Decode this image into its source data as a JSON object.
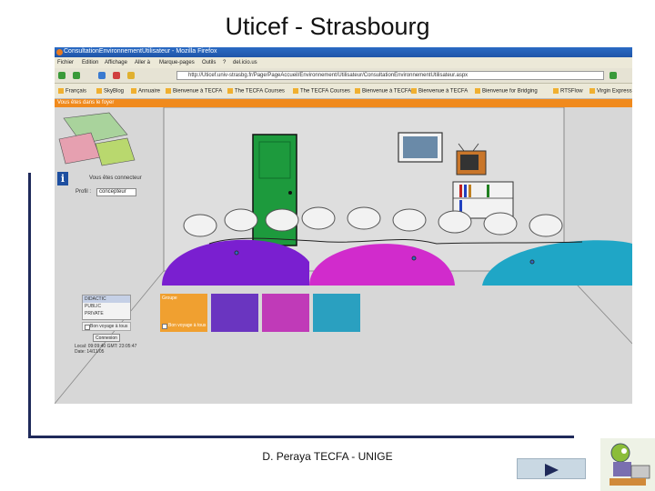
{
  "slide": {
    "title": "Uticef - Strasbourg",
    "footer": "D. Peraya TECFA - UNIGE"
  },
  "browser": {
    "window_title": "ConsultationEnvironnementUtilisateur - Mozilla Firefox",
    "menu": [
      "Fichier",
      "Edition",
      "Affichage",
      "Aller à",
      "Marque-pages",
      "Outils",
      "?",
      "del.icio.us"
    ],
    "url": "http://Uticef.univ-strasbg.fr/Page/PageAccueil/Environnement/Utilisateur/ConsultationEnvironnementUtilisateur.aspx",
    "bookmarks": [
      "Français",
      "SkyBlog",
      "Annuaire",
      "Bienvenue à TECFA",
      "The TECFA Courses",
      "The TECFA Courses",
      "Bienvenue à TECFA",
      "Bienvenue à TECFA",
      "Bienvenue for Bridging",
      "RTSFlow",
      "Virgin Express"
    ],
    "banner": "Vous êtes dans le foyer"
  },
  "app": {
    "logged_label": "Vous êtes connecteur",
    "profil_label": "Profil :",
    "profil_value": "concepteur",
    "list_items": [
      "DIDACTIC",
      "PUBLIC",
      "PRIVATE"
    ],
    "checkbox_label": "Bon voyage à tous",
    "button_label": "Connexion",
    "status_lines": [
      "Local: 09:09:40 GMT: 23:05:47",
      "Date: 14/11/05"
    ],
    "swatch_label": "Groupe",
    "swatch_checkbox_label": "Bon voyage à tous",
    "swatch_colors": [
      "#f0a030",
      "#6a35c0",
      "#c03ab8",
      "#2aa0c0"
    ]
  }
}
